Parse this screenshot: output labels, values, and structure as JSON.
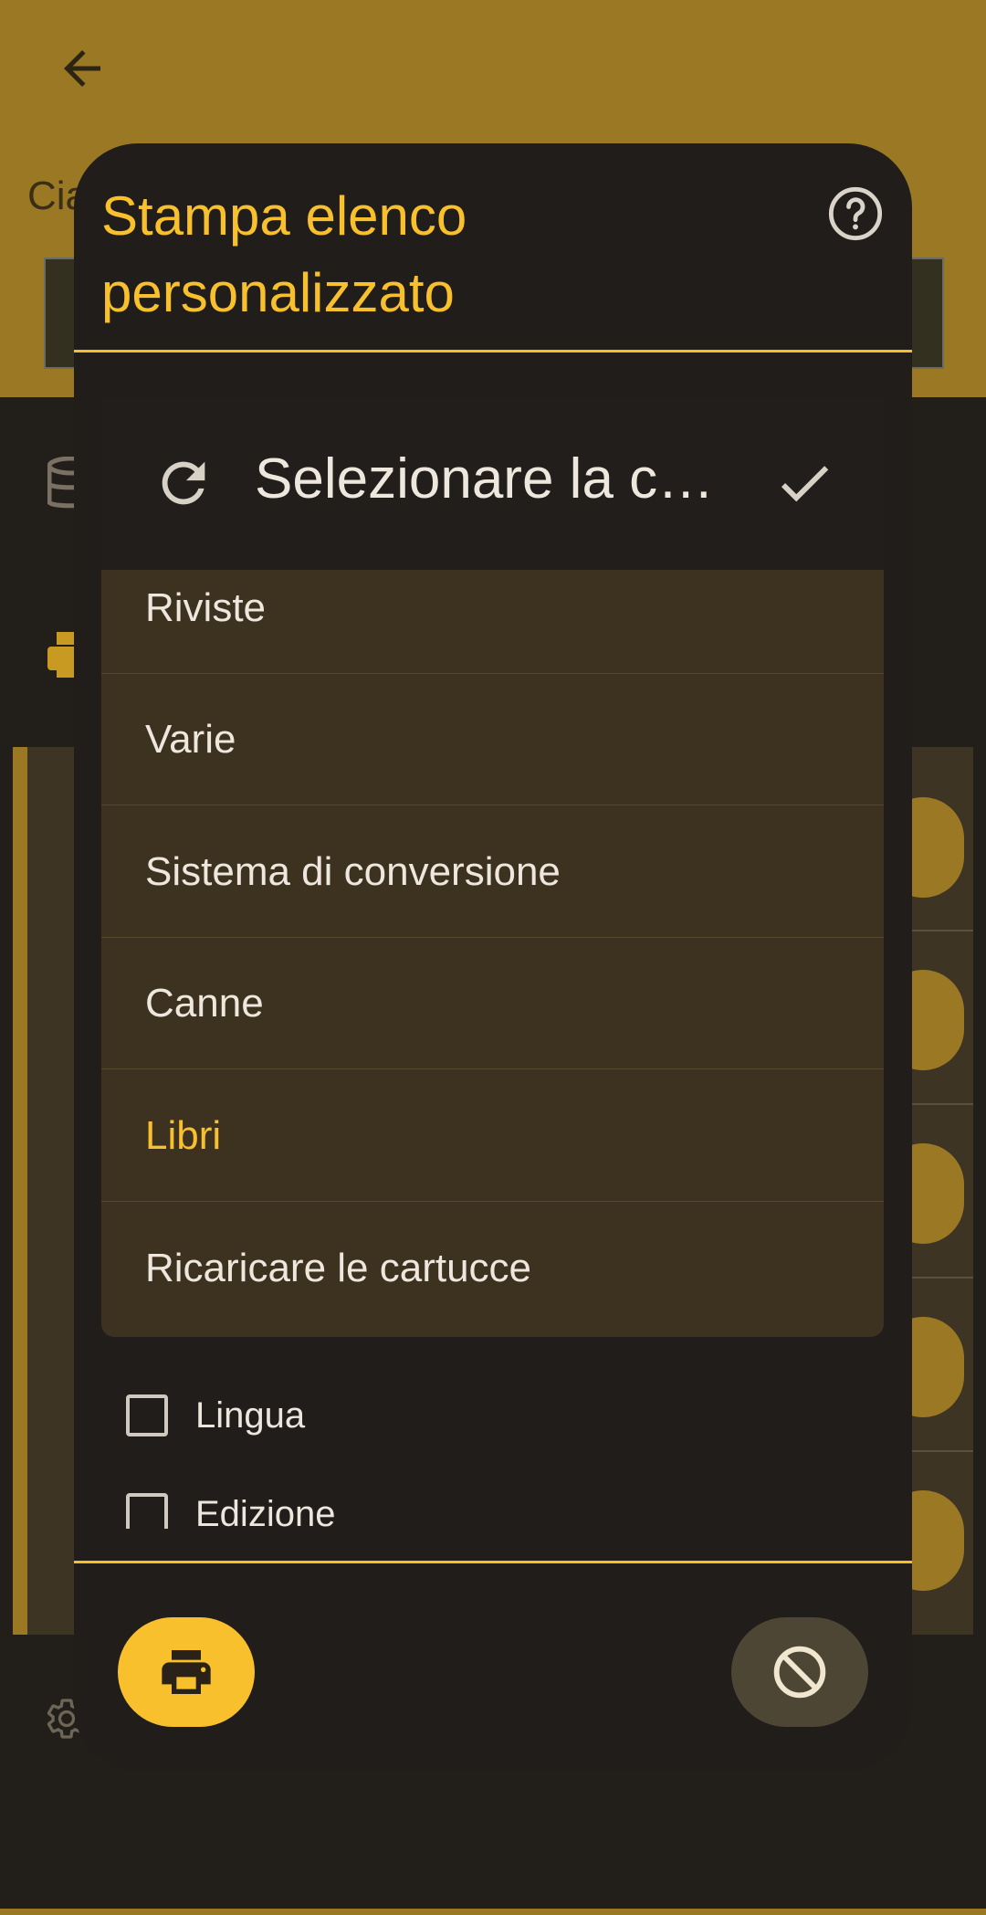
{
  "background": {
    "title_fragment": "Cia"
  },
  "dialog": {
    "title": "Stampa elenco personalizzato",
    "options": [
      {
        "label": "Lingua",
        "checked": false
      },
      {
        "label": "Edizione",
        "checked": false
      }
    ]
  },
  "dropdown": {
    "title": "Selezionare la c…",
    "items": [
      {
        "label": "Riviste"
      },
      {
        "label": "Varie"
      },
      {
        "label": "Sistema di conversione"
      },
      {
        "label": "Canne"
      },
      {
        "label": "Libri",
        "selected": true
      },
      {
        "label": "Ricaricare le cartucce"
      }
    ]
  },
  "colors": {
    "accent": "#f7c02c",
    "header": "#9b7924",
    "surface": "#201d1a",
    "dropdown_bg": "#3d3220"
  },
  "icons": [
    "back-arrow-icon",
    "help-icon",
    "refresh-icon",
    "check-icon",
    "printer-icon",
    "block-icon",
    "database-icon",
    "gear-icon"
  ]
}
